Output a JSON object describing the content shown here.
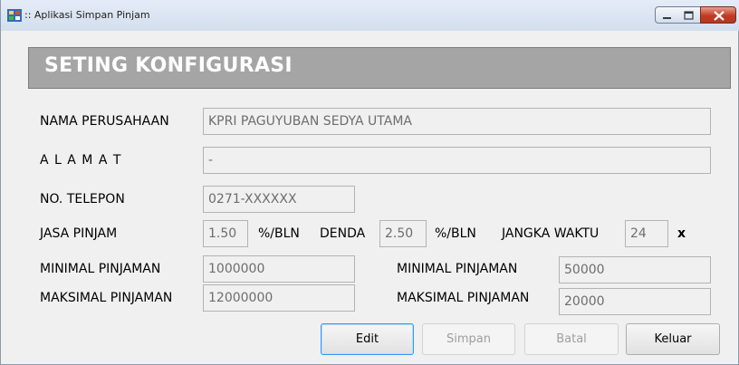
{
  "window": {
    "title": ":: Aplikasi Simpan Pinjam"
  },
  "header": {
    "title": "SETING KONFIGURASI"
  },
  "form": {
    "nama_perusahaan": {
      "label": "NAMA PERUSAHAAN",
      "value": "KPRI PAGUYUBAN SEDYA UTAMA"
    },
    "alamat": {
      "label": "A L A M A T",
      "value": "-"
    },
    "telepon": {
      "label": "NO. TELEPON",
      "value": "0271-XXXXXX"
    },
    "jasa_pinjam": {
      "label": "JASA PINJAM",
      "value": "1.50",
      "unit": "%/BLN"
    },
    "denda": {
      "label": "DENDA",
      "value": "2.50",
      "unit": "%/BLN"
    },
    "jangka_waktu": {
      "label": "JANGKA WAKTU",
      "value": "24",
      "unit": "x"
    },
    "minimal_pinjaman_1": {
      "label": "MINIMAL PINJAMAN",
      "value": "1000000"
    },
    "maksimal_pinjaman_1": {
      "label": "MAKSIMAL PINJAMAN",
      "value": "12000000"
    },
    "minimal_pinjaman_2": {
      "label": "MINIMAL PINJAMAN",
      "value": "50000"
    },
    "maksimal_pinjaman_2": {
      "label": "MAKSIMAL PINJAMAN",
      "value": "20000"
    }
  },
  "buttons": {
    "edit": "Edit",
    "simpan": "Simpan",
    "batal": "Batal",
    "keluar": "Keluar"
  }
}
